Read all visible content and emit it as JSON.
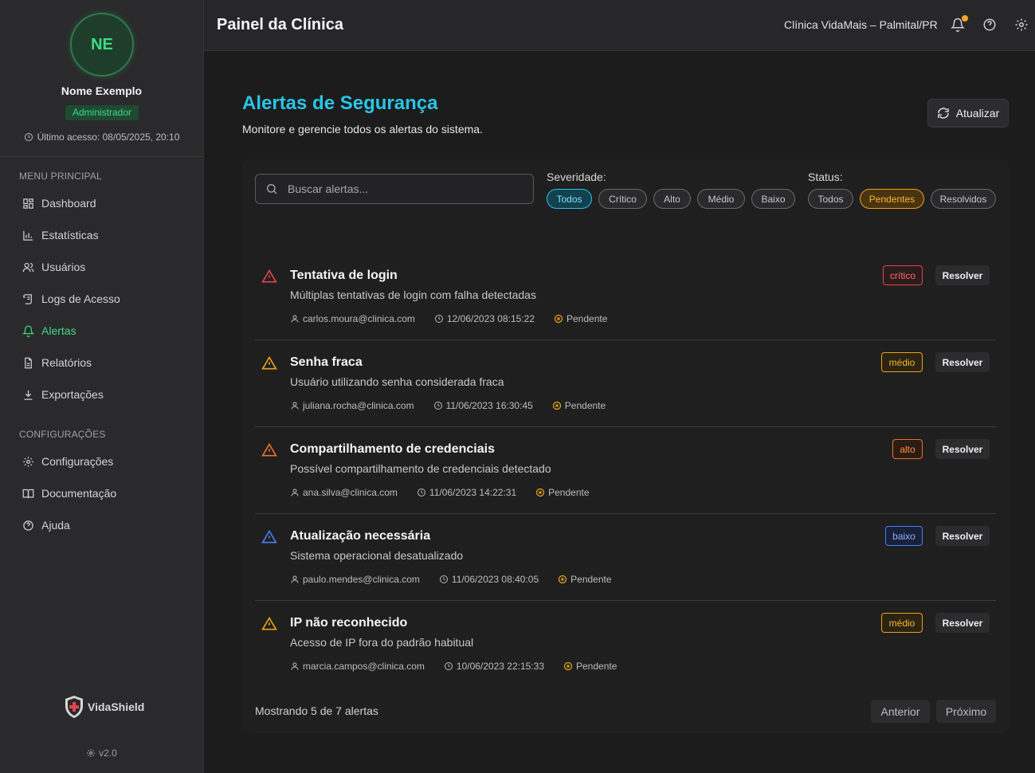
{
  "user": {
    "initials": "NE",
    "name": "Nome Exemplo",
    "role": "Administrador",
    "last_access": "Último acesso: 08/05/2025, 20:10"
  },
  "sidebar": {
    "main_section": "MENU PRINCIPAL",
    "main_items": [
      {
        "label": "Dashboard",
        "icon": "grid-icon"
      },
      {
        "label": "Estatísticas",
        "icon": "bar-chart-icon"
      },
      {
        "label": "Usuários",
        "icon": "users-icon"
      },
      {
        "label": "Logs de Acesso",
        "icon": "scroll-icon"
      },
      {
        "label": "Alertas",
        "icon": "bell-icon",
        "active": true
      },
      {
        "label": "Relatórios",
        "icon": "file-icon"
      },
      {
        "label": "Exportações",
        "icon": "download-icon"
      }
    ],
    "config_section": "CONFIGURAÇÕES",
    "config_items": [
      {
        "label": "Configurações",
        "icon": "gear-icon"
      },
      {
        "label": "Documentação",
        "icon": "book-icon"
      },
      {
        "label": "Ajuda",
        "icon": "help-circle-icon"
      }
    ],
    "brand": "VidaShield",
    "version": "v2.0"
  },
  "header": {
    "title": "Painel da Clínica",
    "clinic": "Clínica VidaMais – Palmital/PR"
  },
  "main": {
    "title": "Alertas de Segurança",
    "subtitle": "Monitore e gerencie todos os alertas do sistema.",
    "refresh_label": "Atualizar",
    "search_placeholder": "Buscar alertas...",
    "severity_label": "Severidade:",
    "severity_options": [
      "Todos",
      "Crítico",
      "Alto",
      "Médio",
      "Baixo"
    ],
    "severity_selected": "Todos",
    "status_label": "Status:",
    "status_options": [
      "Todos",
      "Pendentes",
      "Resolvidos"
    ],
    "status_selected": "Pendentes",
    "resolve_label": "Resolver",
    "alerts": [
      {
        "title": "Tentativa de login",
        "description": "Múltiplas tentativas de login com falha detectadas",
        "severity": "crítico",
        "user": "carlos.moura@clinica.com",
        "datetime": "12/06/2023 08:15:22",
        "status": "Pendente"
      },
      {
        "title": "Senha fraca",
        "description": "Usuário utilizando senha considerada fraca",
        "severity": "médio",
        "user": "juliana.rocha@clinica.com",
        "datetime": "11/06/2023 16:30:45",
        "status": "Pendente"
      },
      {
        "title": "Compartilhamento de credenciais",
        "description": "Possível compartilhamento de credenciais detectado",
        "severity": "alto",
        "user": "ana.silva@clinica.com",
        "datetime": "11/06/2023 14:22:31",
        "status": "Pendente"
      },
      {
        "title": "Atualização necessária",
        "description": "Sistema operacional desatualizado",
        "severity": "baixo",
        "user": "paulo.mendes@clinica.com",
        "datetime": "11/06/2023 08:40:05",
        "status": "Pendente"
      },
      {
        "title": "IP não reconhecido",
        "description": "Acesso de IP fora do padrão habitual",
        "severity": "médio",
        "user": "marcia.campos@clinica.com",
        "datetime": "10/06/2023 22:15:33",
        "status": "Pendente"
      }
    ],
    "showing": "Mostrando 5 de 7 alertas",
    "prev_label": "Anterior",
    "next_label": "Próximo"
  },
  "colors": {
    "accent_cyan": "#29c5e6",
    "accent_green": "#3ddc84",
    "critical": "#e0464d",
    "high": "#e8702a",
    "medium": "#e8a317",
    "low": "#4a7ef0"
  }
}
